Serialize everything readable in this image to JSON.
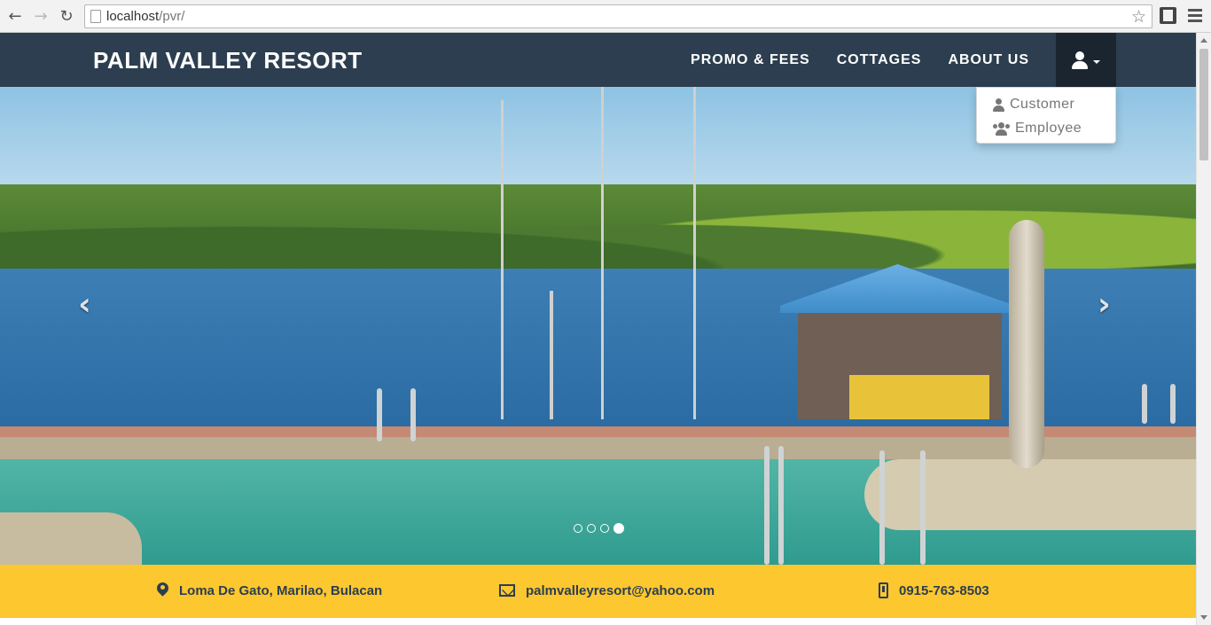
{
  "browser": {
    "url_host": "localhost",
    "url_path": "/pvr/",
    "icons": [
      "back-icon",
      "forward-icon",
      "reload-icon",
      "page-icon",
      "star-icon",
      "film-icon",
      "menu-icon"
    ]
  },
  "navbar": {
    "brand": "PALM VALLEY RESORT",
    "links": [
      "PROMO & FEES",
      "COTTAGES",
      "ABOUT US"
    ],
    "user_icon": "user-icon",
    "background": "#2c3e50"
  },
  "dropdown": {
    "items": [
      {
        "label": "Customer",
        "icon": "user-icon"
      },
      {
        "label": "Employee",
        "icon": "users-icon"
      }
    ]
  },
  "carousel": {
    "slide_count": 4,
    "active_slide": 4,
    "prev_glyph": "‹",
    "next_glyph": "›"
  },
  "info_bar": {
    "background": "#fcc72f",
    "address": "Loma De Gato, Marilao, Bulacan",
    "email": "palmvalleyresort@yahoo.com",
    "phone": "0915-763-8503"
  }
}
